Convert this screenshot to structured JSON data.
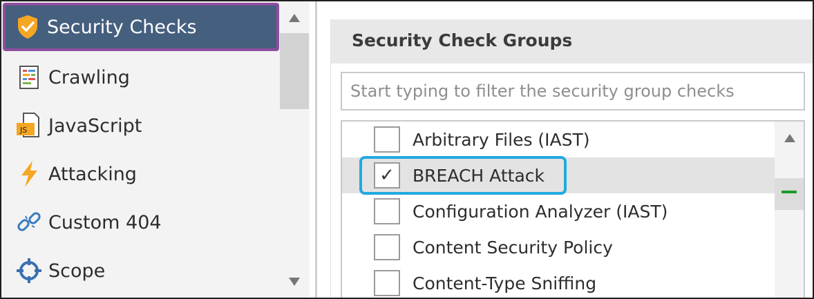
{
  "sidebar": {
    "items": [
      {
        "label": "Security Checks",
        "icon": "shield-check-icon",
        "active": true
      },
      {
        "label": "Crawling",
        "icon": "document-icon",
        "active": false
      },
      {
        "label": "JavaScript",
        "icon": "javascript-file-icon",
        "active": false
      },
      {
        "label": "Attacking",
        "icon": "lightning-icon",
        "active": false
      },
      {
        "label": "Custom 404",
        "icon": "broken-link-icon",
        "active": false
      },
      {
        "label": "Scope",
        "icon": "crosshair-icon",
        "active": false
      }
    ]
  },
  "panel": {
    "title": "Security Check Groups",
    "filter_placeholder": "Start typing to filter the security group checks",
    "checks": [
      {
        "label": "Arbitrary Files (IAST)",
        "checked": false
      },
      {
        "label": "BREACH Attack",
        "checked": true,
        "selected": true
      },
      {
        "label": "Configuration Analyzer (IAST)",
        "checked": false
      },
      {
        "label": "Content Security Policy",
        "checked": false
      },
      {
        "label": "Content-Type Sniffing",
        "checked": false
      }
    ],
    "checkmark": "✓"
  },
  "colors": {
    "active_bg": "#455f7e",
    "active_border": "#8c4e9e",
    "highlight_border": "#22a9e0",
    "scroll_marker": "#1a9a2a"
  }
}
